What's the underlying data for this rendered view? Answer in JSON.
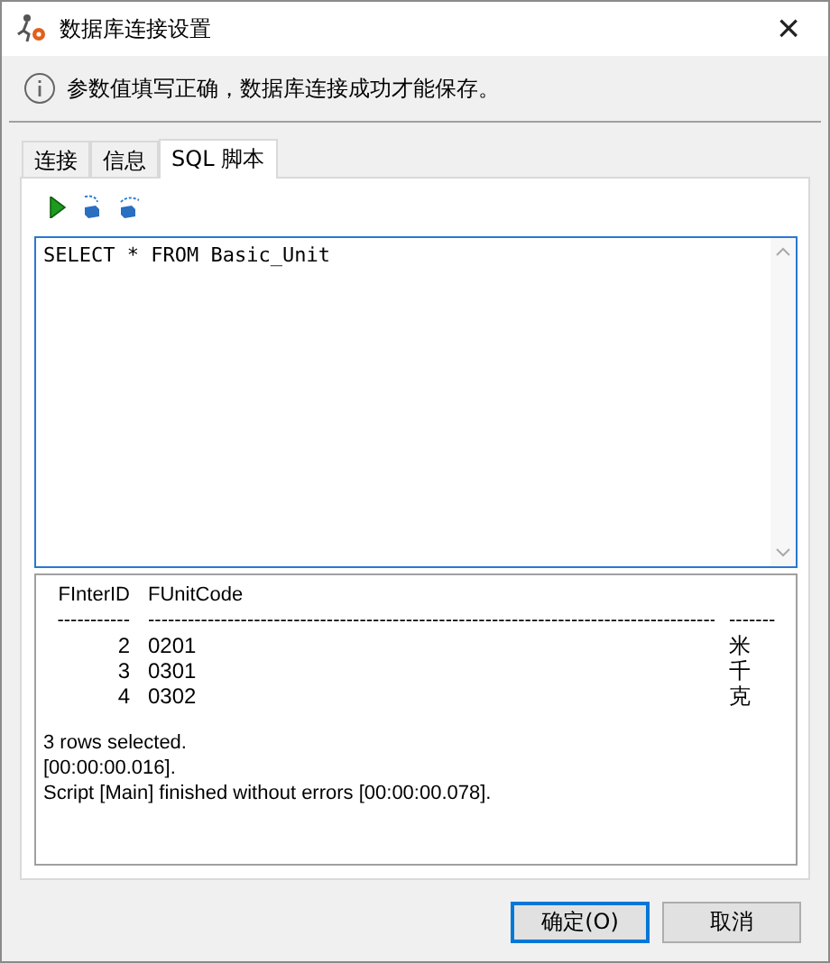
{
  "window": {
    "title": "数据库连接设置",
    "close": "×"
  },
  "info": "参数值填写正确，数据库连接成功才能保存。",
  "tabs": [
    {
      "label": "连接",
      "selected": false
    },
    {
      "label": "信息",
      "selected": false
    },
    {
      "label": "SQL 脚本",
      "selected": true
    }
  ],
  "editor": {
    "value": "SELECT * FROM Basic_Unit"
  },
  "results": {
    "columns": [
      {
        "header": "FInterID",
        "rule": "-----------"
      },
      {
        "header": "FUnitCode",
        "rule": "--------------------------------------------------------------------------------------"
      },
      {
        "rule": "-------"
      }
    ],
    "rows": [
      [
        "2",
        "0201",
        "米"
      ],
      [
        "3",
        "0301",
        "千"
      ],
      [
        "4",
        "0302",
        "克"
      ]
    ],
    "messages": [
      "3 rows selected.",
      "[00:00:00.016].",
      "Script [Main] finished without errors [00:00:00.078]."
    ]
  },
  "buttons": [
    {
      "label": "确定(O)",
      "default": true
    },
    {
      "label": "取消",
      "default": false
    }
  ]
}
